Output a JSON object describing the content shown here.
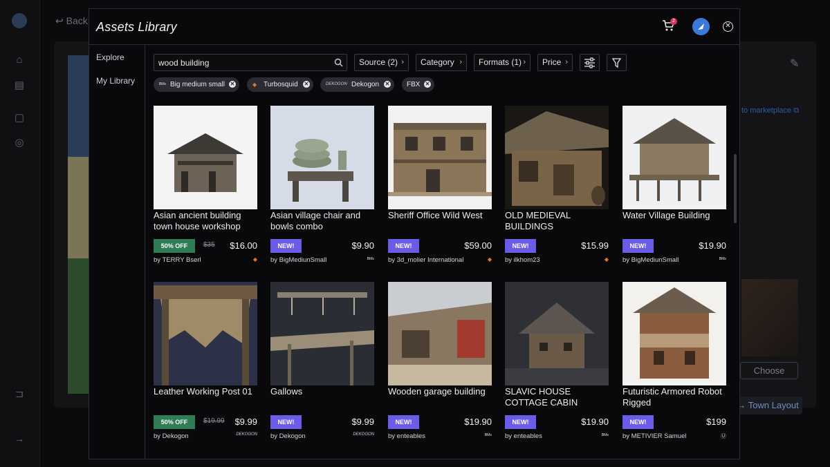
{
  "background": {
    "back_label": "Back",
    "marketplace_link": "to marketplace",
    "choose_label": "Choose",
    "town_layout_label": "Town Layout"
  },
  "modal": {
    "title": "Assets Library",
    "cart_count": "2",
    "close_glyph": "✕"
  },
  "nav": {
    "items": [
      "Explore",
      "My Library"
    ]
  },
  "search": {
    "value": "wood building",
    "placeholder": "Search"
  },
  "filters": [
    {
      "label": "Source (2)"
    },
    {
      "label": "Category"
    },
    {
      "label": "Formats (1)"
    },
    {
      "label": "Price"
    }
  ],
  "chips": [
    {
      "logo": "ᴮᴹˢ",
      "label": "Big medium small"
    },
    {
      "logo": "◆",
      "label": "Turbosquid"
    },
    {
      "logo": "DEKOGON",
      "label": "Dekogon"
    },
    {
      "logo": "",
      "label": "FBX"
    }
  ],
  "assets": [
    {
      "title": "Asian ancient building town house workshop",
      "badge": "50% OFF",
      "old_price": "$35",
      "price": "$16.00",
      "author": "by TERRY Bserl",
      "source": "◆"
    },
    {
      "title": "Asian village chair and bowls combo",
      "badge": "NEW!",
      "old_price": "",
      "price": "$9.90",
      "author": "by BigMediunSmall",
      "source": "ᴮᴹˢ"
    },
    {
      "title": "Sheriff Office Wild West",
      "badge": "NEW!",
      "old_price": "",
      "price": "$59.00",
      "author": "by 3d_molier International",
      "source": "◆"
    },
    {
      "title": "OLD MEDIEVAL BUILDINGS",
      "badge": "NEW!",
      "old_price": "",
      "price": "$15.99",
      "author": "by ilkhom23",
      "source": "◆"
    },
    {
      "title": "Water Village Building",
      "badge": "NEW!",
      "old_price": "",
      "price": "$19.90",
      "author": "by BigMediunSmall",
      "source": "ᴮᴹˢ"
    },
    {
      "title": "Leather Working Post 01",
      "badge": "50% OFF",
      "old_price": "$19.99",
      "price": "$9.99",
      "author": "by Dekogon",
      "source": "DEKOGON"
    },
    {
      "title": "Gallows",
      "badge": "NEW!",
      "old_price": "",
      "price": "$9.99",
      "author": "by Dekogon",
      "source": "DEKOGON"
    },
    {
      "title": "Wooden garage building",
      "badge": "NEW!",
      "old_price": "",
      "price": "$19.90",
      "author": "by enteables",
      "source": "ᴮᴹˢ"
    },
    {
      "title": "SLAVIC HOUSE COTTAGE CABIN",
      "badge": "NEW!",
      "old_price": "",
      "price": "$19.90",
      "author": "by enteables",
      "source": "ᴮᴹˢ"
    },
    {
      "title": "Futuristic Armored Robot Rigged",
      "badge": "NEW!",
      "old_price": "",
      "price": "$199",
      "author": "by METIVIER Samuel",
      "source": "Ⓤ"
    }
  ],
  "icons": {
    "cart": "cart-icon",
    "search": "search-icon",
    "sliders": "sliders-icon",
    "funnel": "funnel-icon"
  },
  "colors": {
    "discount_badge": "#2f7d55",
    "new_badge": "#6b5ce7",
    "accent_blue": "#3b78d8",
    "cart_badge": "#d6345a"
  }
}
